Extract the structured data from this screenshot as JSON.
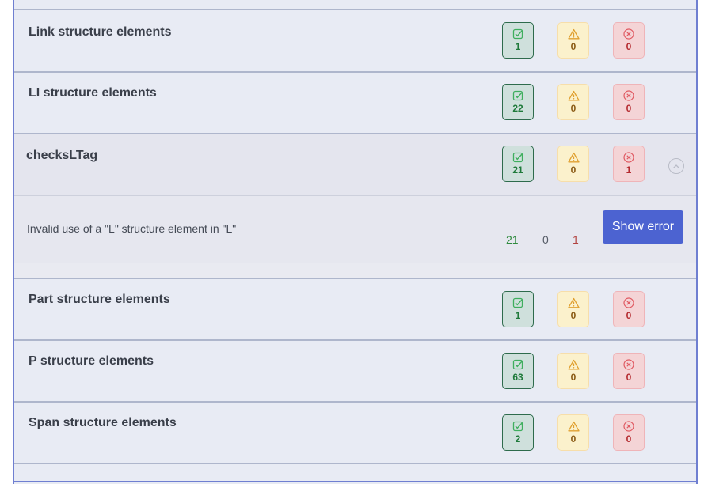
{
  "rows_before": [
    {
      "title": "Link structure elements",
      "pass": "1",
      "warn": "0",
      "fail": "0"
    },
    {
      "title": "LI structure elements",
      "pass": "22",
      "warn": "0",
      "fail": "0"
    }
  ],
  "expanded": {
    "title": "checksLTag",
    "pass": "21",
    "warn": "0",
    "fail": "1",
    "detail": {
      "message": "Invalid use of a \"L\" structure element in \"L\"",
      "pass": "21",
      "warn": "0",
      "fail": "1",
      "button_label": "Show error"
    }
  },
  "rows_after": [
    {
      "title": "Part structure elements",
      "pass": "1",
      "warn": "0",
      "fail": "0"
    },
    {
      "title": "P structure elements",
      "pass": "63",
      "warn": "0",
      "fail": "0"
    },
    {
      "title": "Span structure elements",
      "pass": "2",
      "warn": "0",
      "fail": "0"
    }
  ],
  "icons": {
    "pass": "check-square-icon",
    "warn": "warning-triangle-icon",
    "fail": "x-circle-icon",
    "collapse": "chevron-up-icon"
  },
  "colors": {
    "pass": "#1f7a3a",
    "warn": "#e0a030",
    "fail": "#b42a2f",
    "accent": "#4c63d1",
    "panel_border": "#6f7fd1"
  }
}
